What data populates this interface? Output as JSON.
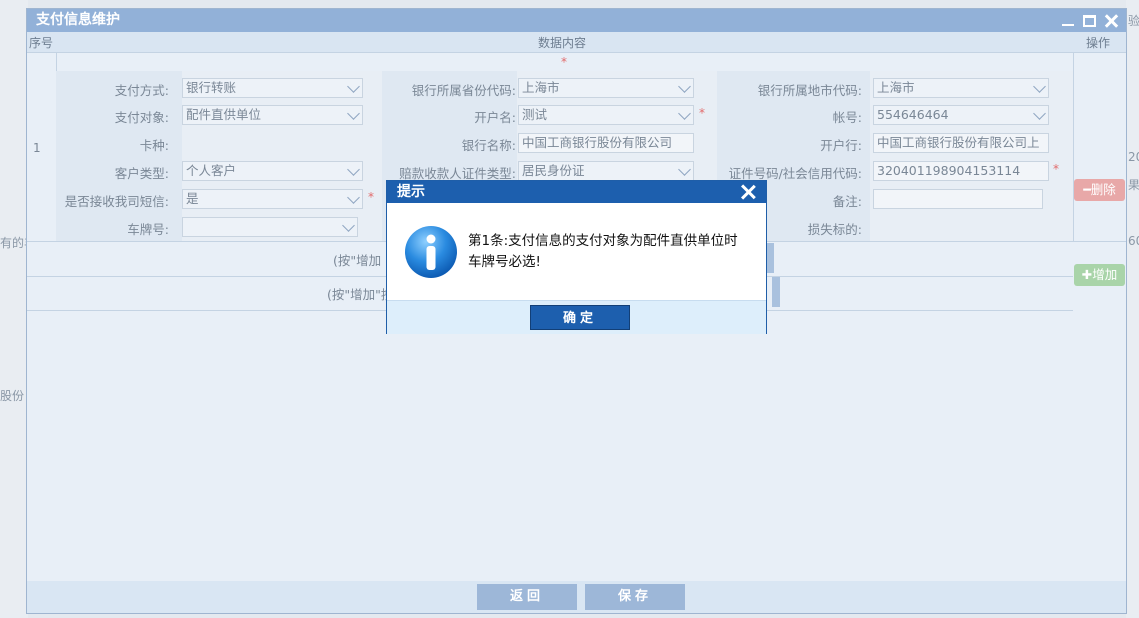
{
  "background_fragments": {
    "left_text_1": "有的丰",
    "left_text_2": "股份",
    "right_text_1": "验",
    "right_text_2": "20",
    "right_text_3": "果",
    "right_text_4": "60"
  },
  "window": {
    "title": "支付信息维护"
  },
  "table": {
    "col_seq": "序号",
    "col_data": "数据内容",
    "col_ops": "操作",
    "required_mark": "*",
    "row_number": "1"
  },
  "form": {
    "pay_method_label": "支付方式:",
    "pay_method_value": "银行转账",
    "bank_province_label": "银行所属省份代码:",
    "bank_province_value": "上海市",
    "bank_city_label": "银行所属地市代码:",
    "bank_city_value": "上海市",
    "pay_target_label": "支付对象:",
    "pay_target_value": "配件直供单位",
    "account_name_label": "开户名:",
    "account_name_value": "测试",
    "account_no_label": "帐号:",
    "account_no_value": "554646464",
    "card_type_label": "卡种:",
    "bank_name_label": "银行名称:",
    "bank_name_value": "中国工商银行股份有限公司",
    "branch_label": "开户行:",
    "branch_value": "中国工商银行股份有限公司上",
    "customer_type_label": "客户类型:",
    "customer_type_value": "个人客户",
    "payee_id_type_label": "赔款收款人证件类型:",
    "payee_id_type_value": "居民身份证",
    "id_number_label": "证件号码/社会信用代码:",
    "id_number_value": "320401198904153114",
    "sms_label": "是否接收我司短信:",
    "sms_value": "是",
    "remark_label": "备注:",
    "plate_label": "车牌号:",
    "loss_target_label": "损失标的:"
  },
  "buttons": {
    "delete": "删除",
    "add": "增加",
    "back": "返回",
    "save": "保存"
  },
  "hints": {
    "hint1": "(按\"增加",
    "hint2": "(按\"增加\"按"
  },
  "dialog": {
    "title": "提示",
    "message_line1": "第1条:支付信息的支付对象为配件直供单位时",
    "message_line2": "车牌号必选!",
    "ok": "确定",
    "icon": "info-icon"
  }
}
